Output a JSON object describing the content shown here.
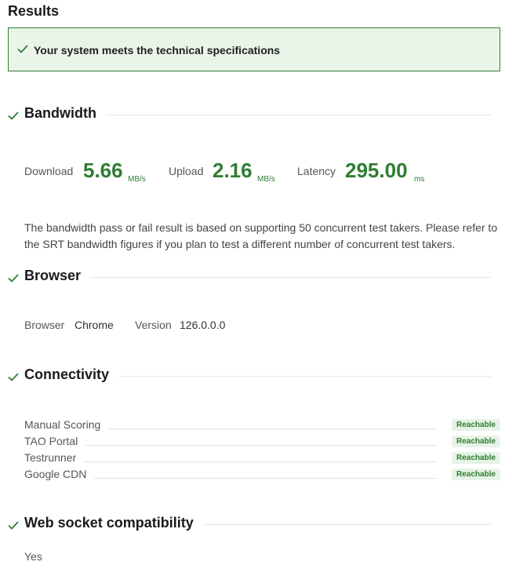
{
  "page": {
    "title": "Results"
  },
  "banner": {
    "icon": "check-icon",
    "message": "Your system meets the technical specifications"
  },
  "bandwidth": {
    "heading": "Bandwidth",
    "download": {
      "label": "Download",
      "value": "5.66",
      "unit": "MB/s"
    },
    "upload": {
      "label": "Upload",
      "value": "2.16",
      "unit": "MB/s"
    },
    "latency": {
      "label": "Latency",
      "value": "295.00",
      "unit": "ms"
    },
    "note": "The bandwidth pass or fail result is based on supporting 50 concurrent test takers. Please refer to the SRT bandwidth figures if you plan to test a different number of concurrent test takers."
  },
  "browser": {
    "heading": "Browser",
    "browser_label": "Browser",
    "browser_value": "Chrome",
    "version_label": "Version",
    "version_value": "126.0.0.0"
  },
  "connectivity": {
    "heading": "Connectivity",
    "items": [
      {
        "name": "Manual Scoring",
        "status": "Reachable"
      },
      {
        "name": "TAO Portal",
        "status": "Reachable"
      },
      {
        "name": "Testrunner",
        "status": "Reachable"
      },
      {
        "name": "Google CDN",
        "status": "Reachable"
      }
    ]
  },
  "websocket": {
    "heading": "Web socket compatibility",
    "value": "Yes"
  },
  "colors": {
    "accent_green": "#2f7d32",
    "banner_background": "#eaf5ea",
    "badge_background": "#e6f3e6"
  }
}
